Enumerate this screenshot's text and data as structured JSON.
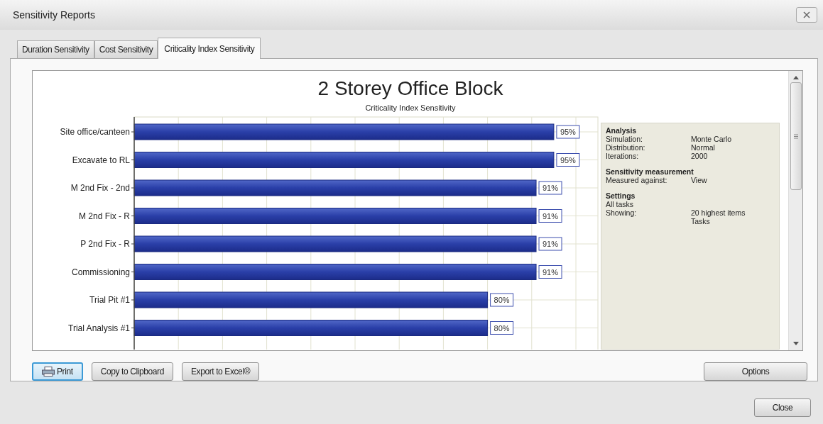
{
  "window": {
    "title": "Sensitivity Reports"
  },
  "tabs": [
    {
      "label": "Duration Sensitivity",
      "selected": false
    },
    {
      "label": "Cost Sensitivity",
      "selected": false
    },
    {
      "label": "Criticality Index Sensitivity",
      "selected": true
    }
  ],
  "report": {
    "title": "2 Storey Office Block",
    "chart_data": {
      "type": "bar",
      "title": "Criticality Index Sensitivity",
      "orientation": "horizontal",
      "categories": [
        "Site office/canteen",
        "Excavate to RL",
        "M 2nd Fix - 2nd",
        "M 2nd Fix - R",
        "P 2nd Fix - R",
        "Commissioning",
        "Trial Pit #1",
        "Trial Analysis #1"
      ],
      "values": [
        95,
        95,
        91,
        91,
        91,
        91,
        80,
        80
      ],
      "data_labels": true,
      "value_labels": [
        "95%",
        "95%",
        "91%",
        "91%",
        "91%",
        "91%",
        "80%",
        "80%"
      ]
    }
  },
  "info": [
    {
      "heading": "Analysis",
      "rows": [
        {
          "label": "Simulation:",
          "value": "Monte Carlo"
        },
        {
          "label": "Distribution:",
          "value": "Normal"
        },
        {
          "label": "Iterations:",
          "value": "2000"
        }
      ]
    },
    {
      "heading": "Sensitivity measurement",
      "rows": [
        {
          "label": "Measured against:",
          "value": "View"
        }
      ]
    },
    {
      "heading": "Settings",
      "rows": [
        {
          "label": "All tasks"
        },
        {
          "label": "Showing:",
          "value": "20 highest items"
        },
        {
          "value": "Tasks"
        }
      ]
    }
  ],
  "actions": [
    {
      "label": "Print",
      "kind": "print",
      "focused": true
    },
    {
      "label": "Copy to Clipboard",
      "kind": "plain",
      "focused": false
    },
    {
      "label": "Export to Excel®",
      "kind": "plain",
      "focused": false
    }
  ],
  "options_button": "Options",
  "close_button": "Close"
}
